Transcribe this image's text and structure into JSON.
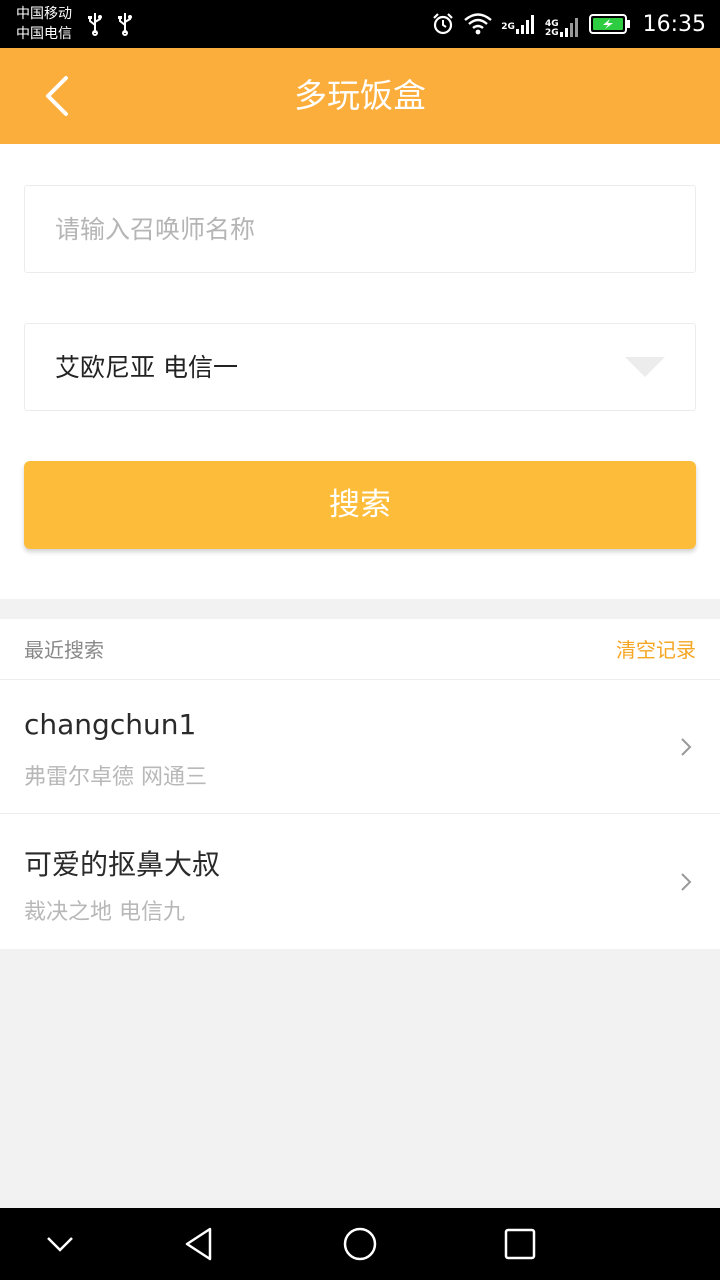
{
  "status_bar": {
    "carrier_1": "中国移动",
    "carrier_2": "中国电信",
    "net_1_tag": "2G",
    "net_2_tag_top": "4G",
    "net_2_tag_bottom": "2G",
    "time": "16:35",
    "icons": [
      "usb-icon",
      "usb-icon",
      "alarm-icon",
      "wifi-icon",
      "signal-icon",
      "signal-icon",
      "battery-charging-icon"
    ]
  },
  "app_bar": {
    "back_icon": "back-arrow-icon",
    "title": "多玩饭盒"
  },
  "form": {
    "summoner_placeholder": "请输入召唤师名称",
    "summoner_value": "",
    "server_selected": "艾欧尼亚 电信一",
    "search_label": "搜索"
  },
  "recent": {
    "title": "最近搜索",
    "clear_label": "清空记录",
    "items": [
      {
        "name": "changchun1",
        "server": "弗雷尔卓德 网通三"
      },
      {
        "name": "可爱的抠鼻大叔",
        "server": "裁决之地 电信九"
      }
    ]
  },
  "nav_bar": {
    "icons": [
      "collapse-icon",
      "back-triangle-icon",
      "home-circle-icon",
      "recents-square-icon"
    ]
  },
  "colors": {
    "app_bar": "#fbae3c",
    "search_button": "#fdbd3a",
    "clear_link": "#f5a623",
    "background": "#f2f2f2"
  }
}
